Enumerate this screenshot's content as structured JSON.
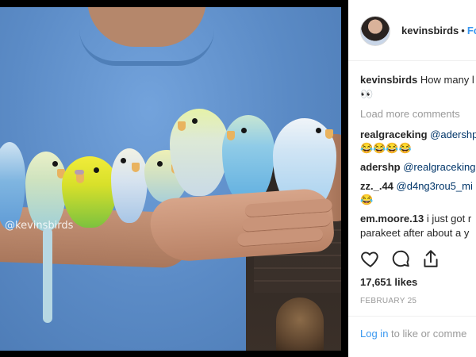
{
  "photo": {
    "watermark": "@kevinsbirds"
  },
  "header": {
    "username": "kevinsbirds",
    "separator": "•",
    "follow_label": "Fo"
  },
  "comments": [
    {
      "user": "kevinsbirds",
      "text": "How many l",
      "emoji_line": "👀"
    },
    {
      "load_more": "Load more comments"
    },
    {
      "user": "realgraceking",
      "mention": "@adershp",
      "emoji_line": "😂😂😂😂"
    },
    {
      "user": "adershp",
      "mention": "@realgraceking"
    },
    {
      "user": "zz._.44",
      "mention": "@d4ng3rou5_mi",
      "emoji_line": "😂"
    },
    {
      "user": "em.moore.13",
      "text": "i just got r",
      "text_line2": "parakeet after about a y"
    }
  ],
  "actions": {
    "like_icon": "heart-icon",
    "comment_icon": "comment-icon",
    "share_icon": "share-icon"
  },
  "likes": "17,651 likes",
  "date": "FEBRUARY 25",
  "footer": {
    "login": "Log in",
    "rest": "to like or comme"
  },
  "colors": {
    "link_blue": "#3897f0",
    "mention_blue": "#003569",
    "muted": "#999999"
  }
}
